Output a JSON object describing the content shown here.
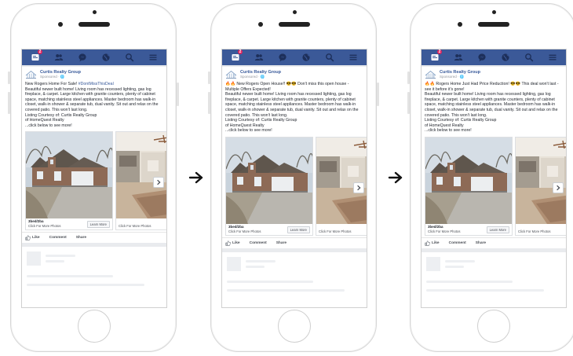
{
  "posts": [
    {
      "page_name": "Curtis Realty Group",
      "sponsored": "Sponsored · ",
      "line1_prefix": "New Rogers Home For Sale! ",
      "line1_hashtag": "#DontMissThisDeal",
      "line1_emoji_suffix": "",
      "body": "Beautiful newer built home! Living room has recessed lighting, gas log fireplace, & carpet. Large kitchen with granite counters, plenty of cabinet space, matching stainless steel appliances. Master bedroom has walk-in closet, walk-in shower & separate tub, dual vanity. Sit out and relax on the covered patio. This won't last long.",
      "listing": "Listing Courtesy of: Curtis Realty Group",
      "brokerage": "of HomeQuest Realty",
      "cta_text": "...click below to see more!",
      "card_title": "3bed/2ba",
      "card_sub": "Click For More Photos",
      "learn_more": "Learn More",
      "card2_sub": "Click For More Photos",
      "like": "Like",
      "comment": "Comment",
      "share": "Share"
    },
    {
      "page_name": "Curtis Realty Group",
      "sponsored": "Sponsored · ",
      "line1_prefix": "🔥🔥 New Rogers Open House!! 😎😎 Don't miss this open house - Multiple Offers Expected!",
      "line1_hashtag": "",
      "line1_emoji_suffix": "",
      "body": "Beautiful newer built home! Living room has recessed lighting, gas log fireplace, & carpet. Large kitchen with granite counters, plenty of cabinet space, matching stainless steel appliances. Master bedroom has walk-in closet, walk-in shower & separate tub, dual vanity. Sit out and relax on the covered patio. This won't last long.",
      "listing": "Listing Courtesy of: Curtis Realty Group",
      "brokerage": "of HomeQuest Realty",
      "cta_text": "...click below to see more!",
      "card_title": "3bed/2ba",
      "card_sub": "Click For More Photos",
      "learn_more": "Learn More",
      "card2_sub": "Click For More Photos",
      "like": "Like",
      "comment": "Comment",
      "share": "Share"
    },
    {
      "page_name": "Curtis Realty Group",
      "sponsored": "Sponsored · ",
      "line1_prefix": "🔥🔥 Rogers Home Just Had Price Reduction! 😎😎 This deal won't last - see it before it's gone!",
      "line1_hashtag": "",
      "line1_emoji_suffix": "",
      "body": "Beautiful newer built home! Living room has recessed lighting, gas log fireplace, & carpet. Large kitchen with granite counters, plenty of cabinet space, matching stainless steel appliances. Master bedroom has walk-in closet, walk-in shower & separate tub, dual vanity. Sit out and relax on the covered patio. This won't last long.",
      "listing": "Listing Courtesy of: Curtis Realty Group",
      "brokerage": "of HomeQuest Realty",
      "cta_text": "...click below to see more!",
      "card_title": "3bed/2ba",
      "card_sub": "Click For More Photos",
      "learn_more": "Learn More",
      "card2_sub": "Click For More Photos",
      "like": "Like",
      "comment": "Comment",
      "share": "Share"
    }
  ],
  "nav": {
    "badge_count": "2",
    "icons": [
      "feed-icon",
      "friends-icon",
      "messenger-icon",
      "globe-icon",
      "search-icon",
      "menu-icon"
    ]
  },
  "colors": {
    "facebook_blue": "#3b5998",
    "link_blue": "#365899",
    "badge_red": "#e0245e"
  }
}
